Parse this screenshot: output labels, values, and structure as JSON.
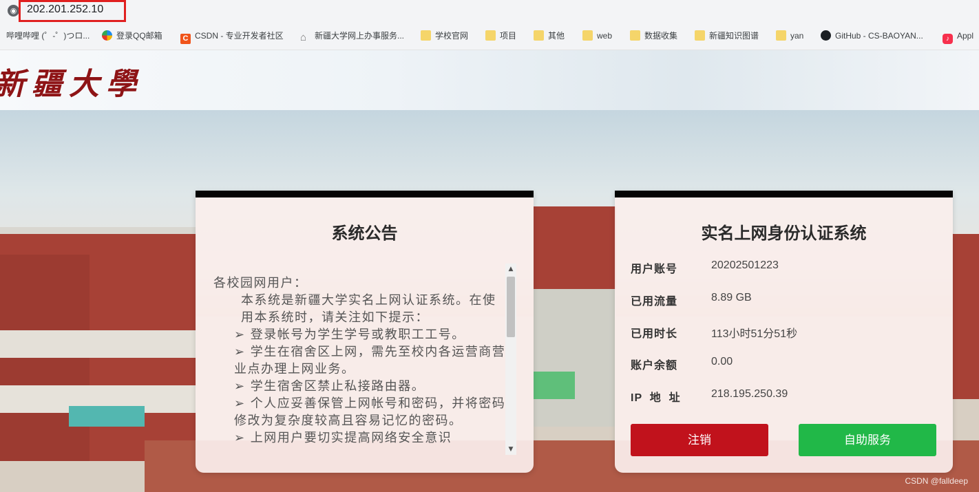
{
  "browser": {
    "url": "202.201.252.10",
    "bookmarks": [
      {
        "label": "哔哩哔哩 (゜-゜)つロ...",
        "icon": "bilibili-icon",
        "color": "#4a4a4a"
      },
      {
        "label": "登录QQ邮箱",
        "icon": "qq-mail-icon",
        "color": "#1f8ceb"
      },
      {
        "label": "CSDN - 专业开发者社区",
        "icon": "csdn-icon",
        "color": "#f0541a"
      },
      {
        "label": "新疆大学网上办事服务...",
        "icon": "home-icon",
        "color": "#888888"
      },
      {
        "label": "学校官网",
        "icon": "folder-icon",
        "color": "#f5d56a"
      },
      {
        "label": "项目",
        "icon": "folder-icon",
        "color": "#f5d56a"
      },
      {
        "label": "其他",
        "icon": "folder-icon",
        "color": "#f5d56a"
      },
      {
        "label": "web",
        "icon": "folder-icon",
        "color": "#f5d56a"
      },
      {
        "label": "数据收集",
        "icon": "folder-icon",
        "color": "#f5d56a"
      },
      {
        "label": "新疆知识图谱",
        "icon": "folder-icon",
        "color": "#f5d56a"
      },
      {
        "label": "yan",
        "icon": "folder-icon",
        "color": "#f5d56a"
      },
      {
        "label": "GitHub - CS-BAOYAN...",
        "icon": "github-icon",
        "color": "#1b1f23"
      },
      {
        "label": "Appl",
        "icon": "apple-music-icon",
        "color": "#f7304d"
      }
    ]
  },
  "header": {
    "logo_text": "新疆大學"
  },
  "notice": {
    "title": "系统公告",
    "lines": [
      "各校园网用户：",
      "本系统是新疆大学实名上网认证系统。在使用本系统时，请关注如下提示：",
      "➢ 登录帐号为学生学号或教职工工号。",
      "➢ 学生在宿舍区上网，需先至校内各运营商营业点办理上网业务。",
      "➢ 学生宿舍区禁止私接路由器。",
      "➢ 个人应妥善保管上网帐号和密码，并将密码修改为复杂度较高且容易记忆的密码。",
      "➢ 上网用户要切实提高网络安全意识"
    ]
  },
  "auth": {
    "title": "实名上网身份认证系统",
    "rows": [
      {
        "label": "用户账号",
        "value": "20202501223"
      },
      {
        "label": "已用流量",
        "value": "8.89 GB"
      },
      {
        "label": "已用时长",
        "value": "113小时51分51秒"
      },
      {
        "label": "账户余额",
        "value": "0.00"
      },
      {
        "label": "IP  地  址",
        "value": "218.195.250.39"
      }
    ],
    "logout_label": "注销",
    "self_service_label": "自助服务",
    "logout_color": "#c1121c",
    "self_service_color": "#21b848"
  },
  "watermark": "CSDN @falldeep"
}
